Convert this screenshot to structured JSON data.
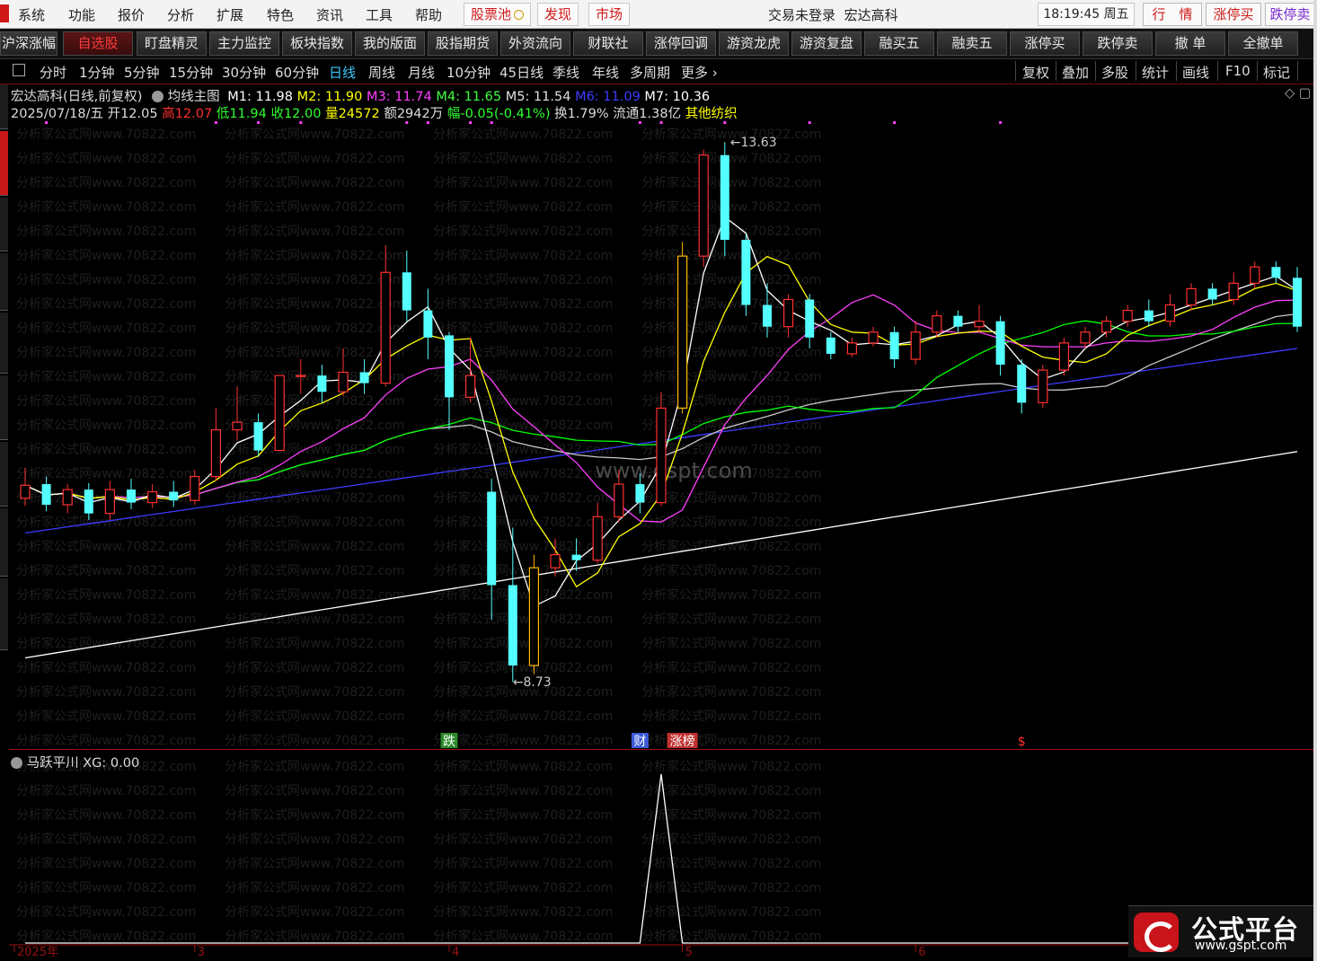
{
  "menu": {
    "items": [
      "系统",
      "功能",
      "报价",
      "分析",
      "扩展",
      "特色",
      "资讯",
      "工具",
      "帮助"
    ],
    "red_items": [
      "股票池",
      "发现",
      "市场"
    ],
    "login_status": "交易未登录",
    "stock_name": "宏达高科",
    "clock": "18:19:45 周五",
    "right_buttons": [
      "行　情",
      "涨停买",
      "跌停卖"
    ]
  },
  "toolbar": {
    "buttons": [
      "沪深涨幅",
      "自选股",
      "盯盘精灵",
      "主力监控",
      "板块指数",
      "我的版面",
      "股指期货",
      "外资流向",
      "财联社",
      "涨停回调",
      "游资龙虎",
      "游资复盘",
      "融买五",
      "融卖五",
      "涨停买",
      "跌停卖",
      "撤 单",
      "全撤单"
    ],
    "active": "自选股"
  },
  "periods": {
    "items": [
      "分时",
      "1分钟",
      "5分钟",
      "15分钟",
      "30分钟",
      "60分钟",
      "日线",
      "周线",
      "月线",
      "10分钟",
      "45日线",
      "季线",
      "年线",
      "多周期",
      "更多"
    ],
    "active": "日线",
    "right": [
      "复权",
      "叠加",
      "多股",
      "统计",
      "画线",
      "F10",
      "标记"
    ]
  },
  "ma_line": {
    "title": "宏达高科(日线,前复权)",
    "indicator": "均线主图",
    "m1": "M1: 11.98",
    "m2": "M2: 11.90",
    "m3": "M3: 11.74",
    "m4": "M4: 11.65",
    "m5": "M5: 11.54",
    "m6": "M6: 11.09",
    "m7": "M7: 10.36"
  },
  "quote_line": {
    "date": "2025/07/18/五",
    "open": "开12.05",
    "high": "高12.07",
    "low": "低11.94",
    "close": "收12.00",
    "volume": "量24572",
    "amount": "额2942万",
    "change": "幅-0.05(-0.41%)",
    "turnover": "换1.79%",
    "float_cap": "流通1.38亿",
    "sector": "其他纺织"
  },
  "chart_data": {
    "type": "candlestick",
    "high_marker": "13.63",
    "low_marker": "8.73",
    "y_range": [
      8.4,
      13.9
    ],
    "event_labels": [
      {
        "text": "跌",
        "index": 20,
        "color": "#2a8a2a"
      },
      {
        "text": "财",
        "index": 29,
        "color": "#3a5ad8"
      },
      {
        "text": "涨榜",
        "index": 31,
        "color": "#c03030"
      },
      {
        "text": "$",
        "index": 47,
        "color": "#ff3030"
      }
    ],
    "candles": [
      [
        10.42,
        10.54,
        10.7,
        10.35
      ],
      [
        10.55,
        10.36,
        10.62,
        10.3
      ],
      [
        10.36,
        10.5,
        10.55,
        10.28
      ],
      [
        10.5,
        10.28,
        10.56,
        10.22
      ],
      [
        10.28,
        10.5,
        10.58,
        10.22
      ],
      [
        10.5,
        10.38,
        10.6,
        10.32
      ],
      [
        10.38,
        10.48,
        10.55,
        10.33
      ],
      [
        10.48,
        10.4,
        10.58,
        10.34
      ],
      [
        10.4,
        10.62,
        10.68,
        10.36
      ],
      [
        10.62,
        11.05,
        11.25,
        10.58
      ],
      [
        11.05,
        11.12,
        11.45,
        10.95
      ],
      [
        11.12,
        10.86,
        11.2,
        10.8
      ],
      [
        10.86,
        11.55,
        11.55,
        10.86
      ],
      [
        11.55,
        11.55,
        11.7,
        11.38
      ],
      [
        11.55,
        11.4,
        11.65,
        11.3
      ],
      [
        11.4,
        11.58,
        11.8,
        11.36
      ],
      [
        11.58,
        11.48,
        11.7,
        11.38
      ],
      [
        11.48,
        12.5,
        12.75,
        11.45
      ],
      [
        12.5,
        12.15,
        12.7,
        12.05
      ],
      [
        12.15,
        11.9,
        12.35,
        11.7
      ],
      [
        11.92,
        11.35,
        11.95,
        11.05
      ],
      [
        11.35,
        11.55,
        11.9,
        11.3
      ],
      [
        10.48,
        9.62,
        10.6,
        9.3
      ],
      [
        9.62,
        8.88,
        10.15,
        8.73
      ],
      [
        8.88,
        9.78,
        9.9,
        8.8
      ],
      [
        9.78,
        9.9,
        10.05,
        9.7
      ],
      [
        9.9,
        9.85,
        10.05,
        9.75
      ],
      [
        9.85,
        10.25,
        10.38,
        9.82
      ],
      [
        10.25,
        10.55,
        10.68,
        10.2
      ],
      [
        10.55,
        10.38,
        10.65,
        10.28
      ],
      [
        10.38,
        11.25,
        11.4,
        10.35
      ],
      [
        11.25,
        12.65,
        12.78,
        11.2
      ],
      [
        12.65,
        13.58,
        13.63,
        12.55
      ],
      [
        13.58,
        12.8,
        13.7,
        12.65
      ],
      [
        12.8,
        12.2,
        12.85,
        12.1
      ],
      [
        12.2,
        12.0,
        12.4,
        11.9
      ],
      [
        12.0,
        12.25,
        12.3,
        11.9
      ],
      [
        12.25,
        11.9,
        12.3,
        11.8
      ],
      [
        11.9,
        11.75,
        11.95,
        11.7
      ],
      [
        11.75,
        11.85,
        11.9,
        11.72
      ],
      [
        11.85,
        11.95,
        12.0,
        11.82
      ],
      [
        11.95,
        11.7,
        12.0,
        11.62
      ],
      [
        11.7,
        11.95,
        12.05,
        11.65
      ],
      [
        11.95,
        12.1,
        12.15,
        11.9
      ],
      [
        12.1,
        12.0,
        12.15,
        11.95
      ],
      [
        12.0,
        12.05,
        12.2,
        11.95
      ],
      [
        12.05,
        11.65,
        12.1,
        11.55
      ],
      [
        11.65,
        11.3,
        11.7,
        11.2
      ],
      [
        11.3,
        11.6,
        11.65,
        11.25
      ],
      [
        11.6,
        11.85,
        11.9,
        11.55
      ],
      [
        11.85,
        11.95,
        12.0,
        11.8
      ],
      [
        11.95,
        12.05,
        12.1,
        11.9
      ],
      [
        12.05,
        12.15,
        12.2,
        12.0
      ],
      [
        12.15,
        12.05,
        12.25,
        12.0
      ],
      [
        12.05,
        12.2,
        12.3,
        12.0
      ],
      [
        12.2,
        12.35,
        12.4,
        12.15
      ],
      [
        12.35,
        12.25,
        12.4,
        12.2
      ],
      [
        12.25,
        12.4,
        12.5,
        12.2
      ],
      [
        12.4,
        12.55,
        12.6,
        12.35
      ],
      [
        12.55,
        12.45,
        12.6,
        12.4
      ],
      [
        12.45,
        12.0,
        12.55,
        11.95
      ]
    ]
  },
  "indicator": {
    "name": "马跃平川",
    "value_label": "XG: 0.00",
    "signal_index": 30
  },
  "time_axis": {
    "labels": [
      "2025年",
      "3",
      "4",
      "5",
      "6"
    ]
  },
  "watermarks": {
    "center": "www.gspt.com",
    "tile": "分析家公式网www.70822.com"
  },
  "brand": {
    "title": "公式平台",
    "url": "www.gspt.com"
  },
  "colors": {
    "up": "#ff3030",
    "down": "#54ffff",
    "limit_up": "#ffb900",
    "limit_down": "#00dd00",
    "m1": "#ffffff",
    "m2": "#ffff00",
    "m3": "#ff40ff",
    "m4": "#00ff00",
    "m5": "#c8c8c8",
    "m6": "#3c3cff",
    "m7": "#ffffff"
  }
}
